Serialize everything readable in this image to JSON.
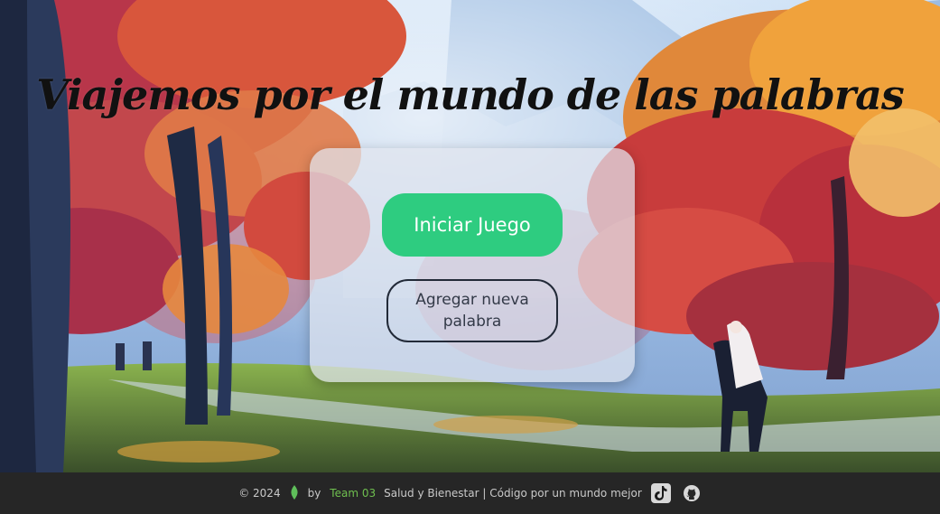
{
  "header": {
    "title": "Viajemos por el mundo de las palabras"
  },
  "card": {
    "start_button": "Iniciar Juego",
    "add_word_button": "Agregar nueva palabra"
  },
  "footer": {
    "copyright": "© 2024",
    "by": "by",
    "team_link": "Team 03",
    "tagline": "Salud y Bienestar | Código por un mundo mejor",
    "icons": [
      "leaf-icon",
      "tiktok-icon",
      "github-icon"
    ]
  },
  "colors": {
    "primary_button": "#2ecc80",
    "footer_bg": "#262626",
    "team_link": "#6fbf4f"
  }
}
